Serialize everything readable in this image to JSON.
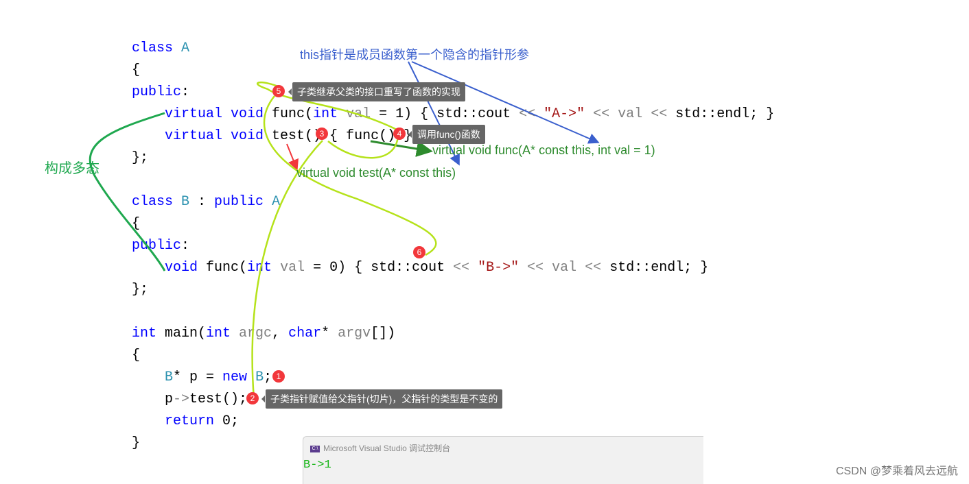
{
  "code": [
    [
      [
        "class ",
        "kw"
      ],
      [
        "A",
        "ty"
      ]
    ],
    [
      [
        "{",
        ""
      ]
    ],
    [
      [
        "public",
        "kw"
      ],
      [
        ":",
        ""
      ]
    ],
    [
      [
        "    virtual void ",
        "kw"
      ],
      [
        "func(",
        ""
      ],
      [
        "int ",
        "kw"
      ],
      [
        "val",
        "pa"
      ],
      [
        " = 1) { std::cout ",
        ""
      ],
      [
        "<< ",
        "op"
      ],
      [
        "\"A->\"",
        "st"
      ],
      [
        " << ",
        "op"
      ],
      [
        "val",
        "pa"
      ],
      [
        " << ",
        "op"
      ],
      [
        "std::endl; }",
        ""
      ]
    ],
    [
      [
        "    virtual void ",
        "kw"
      ],
      [
        "test() { func() }",
        ""
      ]
    ],
    [
      [
        "};",
        ""
      ]
    ],
    [],
    [
      [
        "class ",
        "kw"
      ],
      [
        "B",
        "ty"
      ],
      [
        " : ",
        ""
      ],
      [
        "public ",
        "kw"
      ],
      [
        "A",
        "ty"
      ]
    ],
    [
      [
        "{",
        ""
      ]
    ],
    [
      [
        "public",
        "kw"
      ],
      [
        ":",
        ""
      ]
    ],
    [
      [
        "    void ",
        "kw"
      ],
      [
        "func(",
        ""
      ],
      [
        "int ",
        "kw"
      ],
      [
        "val",
        "pa"
      ],
      [
        " = 0) { std::cout ",
        ""
      ],
      [
        "<< ",
        "op"
      ],
      [
        "\"B->\"",
        "st"
      ],
      [
        " << ",
        "op"
      ],
      [
        "val",
        "pa"
      ],
      [
        " << ",
        "op"
      ],
      [
        "std::endl; }",
        ""
      ]
    ],
    [
      [
        "};",
        ""
      ]
    ],
    [],
    [
      [
        "int ",
        "kw"
      ],
      [
        "main(",
        ""
      ],
      [
        "int ",
        "kw"
      ],
      [
        "argc",
        "pa"
      ],
      [
        ", ",
        ""
      ],
      [
        "char",
        "kw"
      ],
      [
        "* ",
        ""
      ],
      [
        "argv",
        "pa"
      ],
      [
        "[])",
        ""
      ]
    ],
    [
      [
        "{",
        ""
      ]
    ],
    [
      [
        "    ",
        ""
      ],
      [
        "B",
        "ty"
      ],
      [
        "* p = ",
        ""
      ],
      [
        "new ",
        "kw"
      ],
      [
        "B",
        "ty"
      ],
      [
        ";",
        ""
      ]
    ],
    [
      [
        "    p",
        ""
      ],
      [
        "->",
        "op"
      ],
      [
        "test();",
        ""
      ]
    ],
    [
      [
        "    return ",
        "kw"
      ],
      [
        "0;",
        ""
      ]
    ],
    [
      [
        "}",
        ""
      ]
    ]
  ],
  "annotations": {
    "this_note": "this指针是成员函数第一个隐含的指针形参",
    "polymorphism": "构成多态",
    "func_sig": "virtual void func(A* const this, int val = 1)",
    "test_sig": "virtual  void test(A* const this)",
    "note5": "子类继承父类的接口重写了函数的实现",
    "note4": "调用func()函数",
    "note2": "子类指针赋值给父指针(切片)，父指针的类型是不变的",
    "badges": [
      "1",
      "2",
      "3",
      "4",
      "5",
      "6"
    ]
  },
  "console": {
    "title": "Microsoft Visual Studio 调试控制台",
    "icon": "console-icon",
    "icon_text": "C:\\",
    "output": "B->1"
  },
  "watermark": "CSDN @梦乘着风去远航",
  "colors": {
    "keyword": "#0000ff",
    "type": "#2b91af",
    "string": "#a31515",
    "blue_note": "#3a5fcd",
    "green_note": "#2e8b2e",
    "highlighter": "#b5e21a",
    "badge": "#f2373b"
  }
}
